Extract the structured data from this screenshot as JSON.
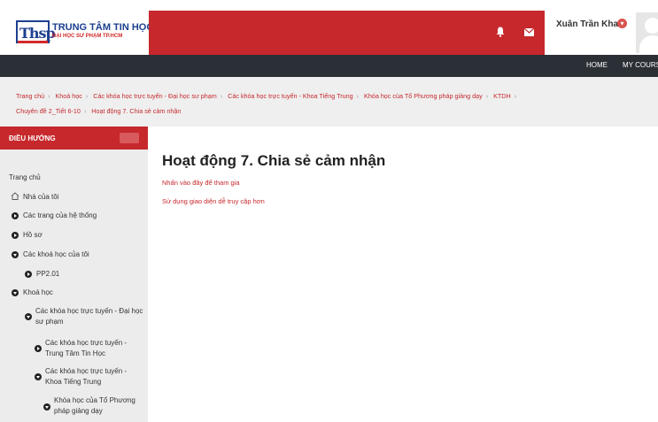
{
  "brand": {
    "mark": "Thsp",
    "title": "TRUNG TÂM TIN HỌC",
    "subtitle": "ĐẠI HỌC SƯ PHẠM TP.HCM",
    "red": "#c6282c"
  },
  "header": {
    "user_name": "Xuân Trần Khai",
    "caret": "▾"
  },
  "nav": {
    "home": "HOME",
    "my_courses": "MY COURSES"
  },
  "breadcrumb": [
    "Trang chủ",
    "Khoá học",
    "Các khóa học trực tuyến - Đại học sư phạm",
    "Các khóa học trực tuyến - Khoa Tiếng Trung",
    "Khóa học của Tổ Phương pháp giảng dạy",
    "KTDH",
    "Chuyên đề 2_Tiết 6-10",
    "Hoạt động 7. Chia sẻ cảm nhận"
  ],
  "sidebar": {
    "heading": "ĐIỀU HƯỚNG",
    "items": [
      "Trang chủ",
      "Nhà của tôi",
      "Các trang của hệ thống",
      "Hồ sơ",
      "Các khoá học của tôi",
      "PP2.01",
      "Khoá học",
      "Các khóa học trực tuyến - Đại học sư phạm",
      "Các khóa học trực tuyến - Trung Tâm Tin Học",
      "Các khóa học trực tuyến - Khoa Tiếng Trung",
      "Khóa học của Tổ Phương pháp giảng dạy"
    ]
  },
  "main": {
    "title": "Hoạt động 7. Chia sẻ cảm nhận",
    "join_link": "Nhấn vào đây để tham gia",
    "access_link": "Sử dụng giao diện dễ truy cập hơn"
  }
}
